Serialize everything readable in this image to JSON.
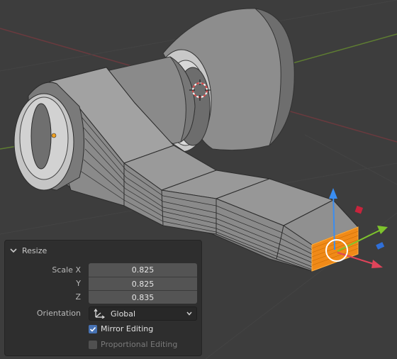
{
  "panel": {
    "title": "Resize",
    "scale_x_label": "Scale X",
    "y_label": "Y",
    "z_label": "Z",
    "scale_x": "0.825",
    "scale_y": "0.825",
    "scale_z": "0.835",
    "orientation_label": "Orientation",
    "orientation_value": "Global",
    "mirror_editing_label": "Mirror Editing",
    "mirror_editing_checked": true,
    "proportional_editing_label": "Proportional Editing",
    "proportional_editing_checked": false
  },
  "icons": {
    "collapse": "chevron-down-icon",
    "orientation": "global-orientation-icon",
    "dropdown": "chevron-down-icon",
    "checkmark": "checkmark-icon"
  },
  "colors": {
    "background": "#3d3d3d",
    "selection": "#f08a18",
    "gizmo_x": "#e0445a",
    "gizmo_y": "#7ec42c",
    "gizmo_z": "#3a8df0",
    "checkbox_on": "#4772b3"
  }
}
